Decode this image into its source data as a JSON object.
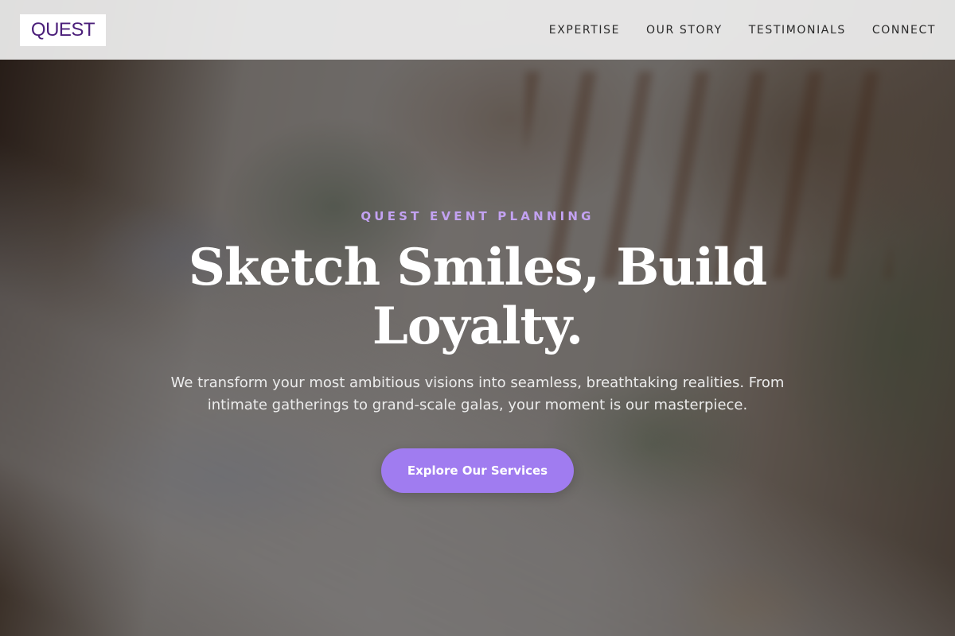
{
  "header": {
    "logo_text": "QUEST",
    "nav": [
      {
        "label": "EXPERTISE"
      },
      {
        "label": "OUR STORY"
      },
      {
        "label": "TESTIMONIALS"
      },
      {
        "label": "CONNECT"
      }
    ]
  },
  "hero": {
    "eyebrow": "QUEST EVENT PLANNING",
    "headline": "Sketch Smiles, Build Loyalty.",
    "subtext": "We transform your most ambitious visions into seamless, breathtaking realities. From intimate gatherings to grand-scale galas, your moment is our masterpiece.",
    "cta_label": "Explore Our Services",
    "background_image": "banquet-table-photo"
  },
  "colors": {
    "brand_purple": "#4b1f7a",
    "accent_lavender": "#c3a2f2",
    "cta_purple": "#a07cf0",
    "header_bg": "#eeeeee"
  }
}
